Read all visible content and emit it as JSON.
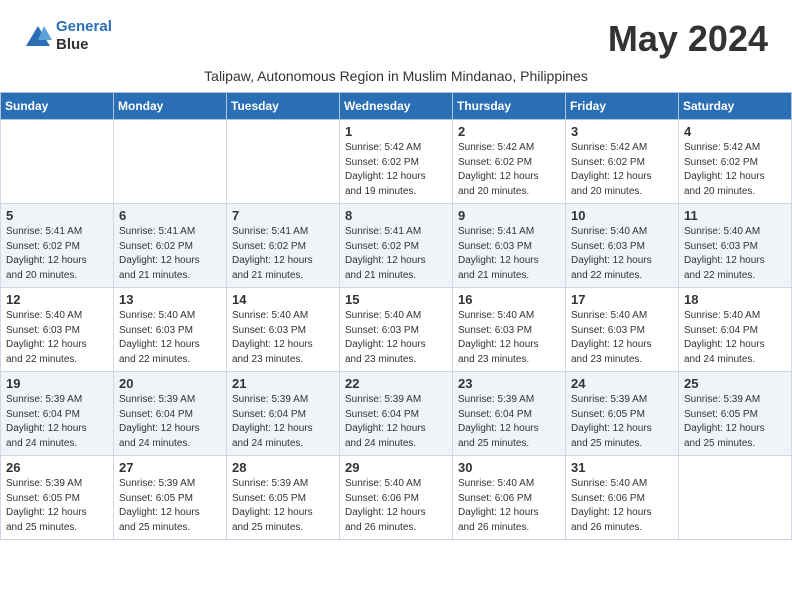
{
  "app": {
    "logo_line1": "General",
    "logo_line2": "Blue",
    "month": "May 2024",
    "subtitle": "Talipaw, Autonomous Region in Muslim Mindanao, Philippines"
  },
  "calendar": {
    "headers": [
      "Sunday",
      "Monday",
      "Tuesday",
      "Wednesday",
      "Thursday",
      "Friday",
      "Saturday"
    ],
    "weeks": [
      [
        {
          "day": "",
          "info": ""
        },
        {
          "day": "",
          "info": ""
        },
        {
          "day": "",
          "info": ""
        },
        {
          "day": "1",
          "info": "Sunrise: 5:42 AM\nSunset: 6:02 PM\nDaylight: 12 hours\nand 19 minutes."
        },
        {
          "day": "2",
          "info": "Sunrise: 5:42 AM\nSunset: 6:02 PM\nDaylight: 12 hours\nand 20 minutes."
        },
        {
          "day": "3",
          "info": "Sunrise: 5:42 AM\nSunset: 6:02 PM\nDaylight: 12 hours\nand 20 minutes."
        },
        {
          "day": "4",
          "info": "Sunrise: 5:42 AM\nSunset: 6:02 PM\nDaylight: 12 hours\nand 20 minutes."
        }
      ],
      [
        {
          "day": "5",
          "info": "Sunrise: 5:41 AM\nSunset: 6:02 PM\nDaylight: 12 hours\nand 20 minutes."
        },
        {
          "day": "6",
          "info": "Sunrise: 5:41 AM\nSunset: 6:02 PM\nDaylight: 12 hours\nand 21 minutes."
        },
        {
          "day": "7",
          "info": "Sunrise: 5:41 AM\nSunset: 6:02 PM\nDaylight: 12 hours\nand 21 minutes."
        },
        {
          "day": "8",
          "info": "Sunrise: 5:41 AM\nSunset: 6:02 PM\nDaylight: 12 hours\nand 21 minutes."
        },
        {
          "day": "9",
          "info": "Sunrise: 5:41 AM\nSunset: 6:03 PM\nDaylight: 12 hours\nand 21 minutes."
        },
        {
          "day": "10",
          "info": "Sunrise: 5:40 AM\nSunset: 6:03 PM\nDaylight: 12 hours\nand 22 minutes."
        },
        {
          "day": "11",
          "info": "Sunrise: 5:40 AM\nSunset: 6:03 PM\nDaylight: 12 hours\nand 22 minutes."
        }
      ],
      [
        {
          "day": "12",
          "info": "Sunrise: 5:40 AM\nSunset: 6:03 PM\nDaylight: 12 hours\nand 22 minutes."
        },
        {
          "day": "13",
          "info": "Sunrise: 5:40 AM\nSunset: 6:03 PM\nDaylight: 12 hours\nand 22 minutes."
        },
        {
          "day": "14",
          "info": "Sunrise: 5:40 AM\nSunset: 6:03 PM\nDaylight: 12 hours\nand 23 minutes."
        },
        {
          "day": "15",
          "info": "Sunrise: 5:40 AM\nSunset: 6:03 PM\nDaylight: 12 hours\nand 23 minutes."
        },
        {
          "day": "16",
          "info": "Sunrise: 5:40 AM\nSunset: 6:03 PM\nDaylight: 12 hours\nand 23 minutes."
        },
        {
          "day": "17",
          "info": "Sunrise: 5:40 AM\nSunset: 6:03 PM\nDaylight: 12 hours\nand 23 minutes."
        },
        {
          "day": "18",
          "info": "Sunrise: 5:40 AM\nSunset: 6:04 PM\nDaylight: 12 hours\nand 24 minutes."
        }
      ],
      [
        {
          "day": "19",
          "info": "Sunrise: 5:39 AM\nSunset: 6:04 PM\nDaylight: 12 hours\nand 24 minutes."
        },
        {
          "day": "20",
          "info": "Sunrise: 5:39 AM\nSunset: 6:04 PM\nDaylight: 12 hours\nand 24 minutes."
        },
        {
          "day": "21",
          "info": "Sunrise: 5:39 AM\nSunset: 6:04 PM\nDaylight: 12 hours\nand 24 minutes."
        },
        {
          "day": "22",
          "info": "Sunrise: 5:39 AM\nSunset: 6:04 PM\nDaylight: 12 hours\nand 24 minutes."
        },
        {
          "day": "23",
          "info": "Sunrise: 5:39 AM\nSunset: 6:04 PM\nDaylight: 12 hours\nand 25 minutes."
        },
        {
          "day": "24",
          "info": "Sunrise: 5:39 AM\nSunset: 6:05 PM\nDaylight: 12 hours\nand 25 minutes."
        },
        {
          "day": "25",
          "info": "Sunrise: 5:39 AM\nSunset: 6:05 PM\nDaylight: 12 hours\nand 25 minutes."
        }
      ],
      [
        {
          "day": "26",
          "info": "Sunrise: 5:39 AM\nSunset: 6:05 PM\nDaylight: 12 hours\nand 25 minutes."
        },
        {
          "day": "27",
          "info": "Sunrise: 5:39 AM\nSunset: 6:05 PM\nDaylight: 12 hours\nand 25 minutes."
        },
        {
          "day": "28",
          "info": "Sunrise: 5:39 AM\nSunset: 6:05 PM\nDaylight: 12 hours\nand 25 minutes."
        },
        {
          "day": "29",
          "info": "Sunrise: 5:40 AM\nSunset: 6:06 PM\nDaylight: 12 hours\nand 26 minutes."
        },
        {
          "day": "30",
          "info": "Sunrise: 5:40 AM\nSunset: 6:06 PM\nDaylight: 12 hours\nand 26 minutes."
        },
        {
          "day": "31",
          "info": "Sunrise: 5:40 AM\nSunset: 6:06 PM\nDaylight: 12 hours\nand 26 minutes."
        },
        {
          "day": "",
          "info": ""
        }
      ]
    ]
  }
}
